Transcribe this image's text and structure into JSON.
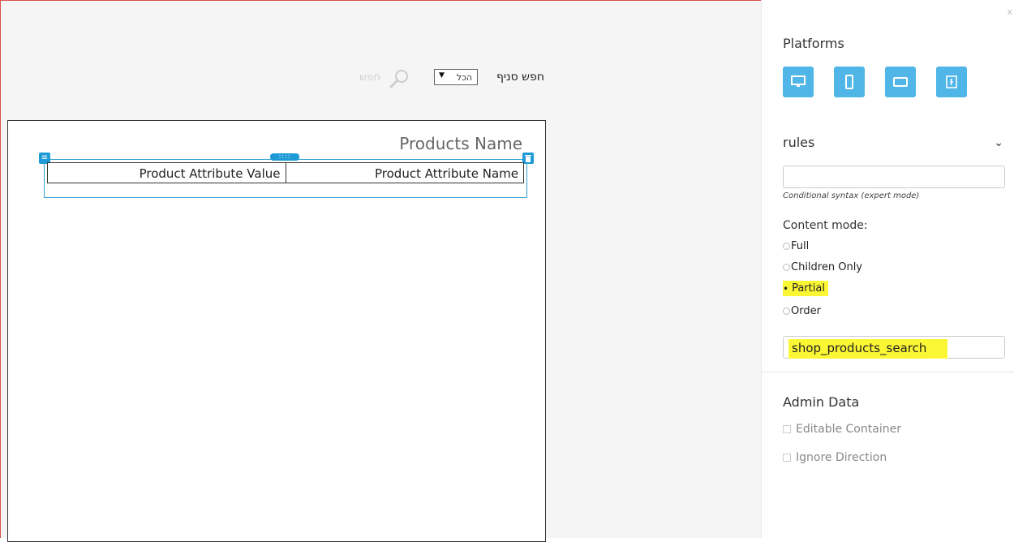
{
  "editor": {
    "search": {
      "label": "חפש סניף",
      "select_value": "הכל",
      "select_arrow": "▼",
      "ghost_text": "חפש"
    },
    "canvas": {
      "title": "Products Name",
      "table": {
        "columns": [
          "Product Attribute Value",
          "Product Attribute Name"
        ]
      },
      "handles": {
        "menu": "≡",
        "drag": "::::",
        "delete": "🗑"
      }
    }
  },
  "panel": {
    "close": "x",
    "platforms": {
      "title": "Platforms",
      "buttons": [
        "desktop-icon",
        "mobile-icon",
        "tablet-icon",
        "facebook-icon"
      ],
      "color": "#4fb6e7"
    },
    "rules": {
      "label": "rules",
      "chevron": "⌄",
      "input_value": "",
      "help": "Conditional syntax (expert mode)"
    },
    "content_mode": {
      "label": "Content mode:",
      "options": [
        "Full",
        "Children Only",
        "Partial",
        "Order"
      ],
      "selected": "Partial",
      "checked_mark": "•"
    },
    "partial_input_value": "shop_products_search",
    "admin": {
      "title": "Admin Data",
      "checkboxes": [
        "Editable Container",
        "Ignore Direction"
      ]
    },
    "highlight_color": "#fbf735"
  }
}
